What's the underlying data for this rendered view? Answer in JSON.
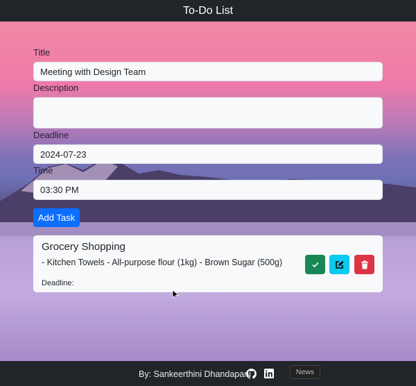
{
  "header": {
    "title": "To-Do List"
  },
  "form": {
    "title_label": "Title",
    "title_value": "Meeting with Design Team",
    "description_label": "Description",
    "description_value": "",
    "deadline_label": "Deadline",
    "deadline_value": "2024-07-23",
    "time_label": "Time",
    "time_value": "03:30 PM",
    "add_button": "Add Task"
  },
  "tasks": [
    {
      "title": "Grocery Shopping",
      "description": "- Kitchen Towels - All-purpose flour (1kg) - Brown Sugar (500g)",
      "deadline_label": "Deadline:",
      "deadline_value": ""
    }
  ],
  "actions": {
    "complete_color": "#198754",
    "edit_color": "#0dcaf0",
    "delete_color": "#dc3545"
  },
  "footer": {
    "author": "By: Sankeerthini Dhandapani",
    "github_icon": "github-icon",
    "linkedin_icon": "linkedin-icon",
    "tooltip": "News"
  }
}
